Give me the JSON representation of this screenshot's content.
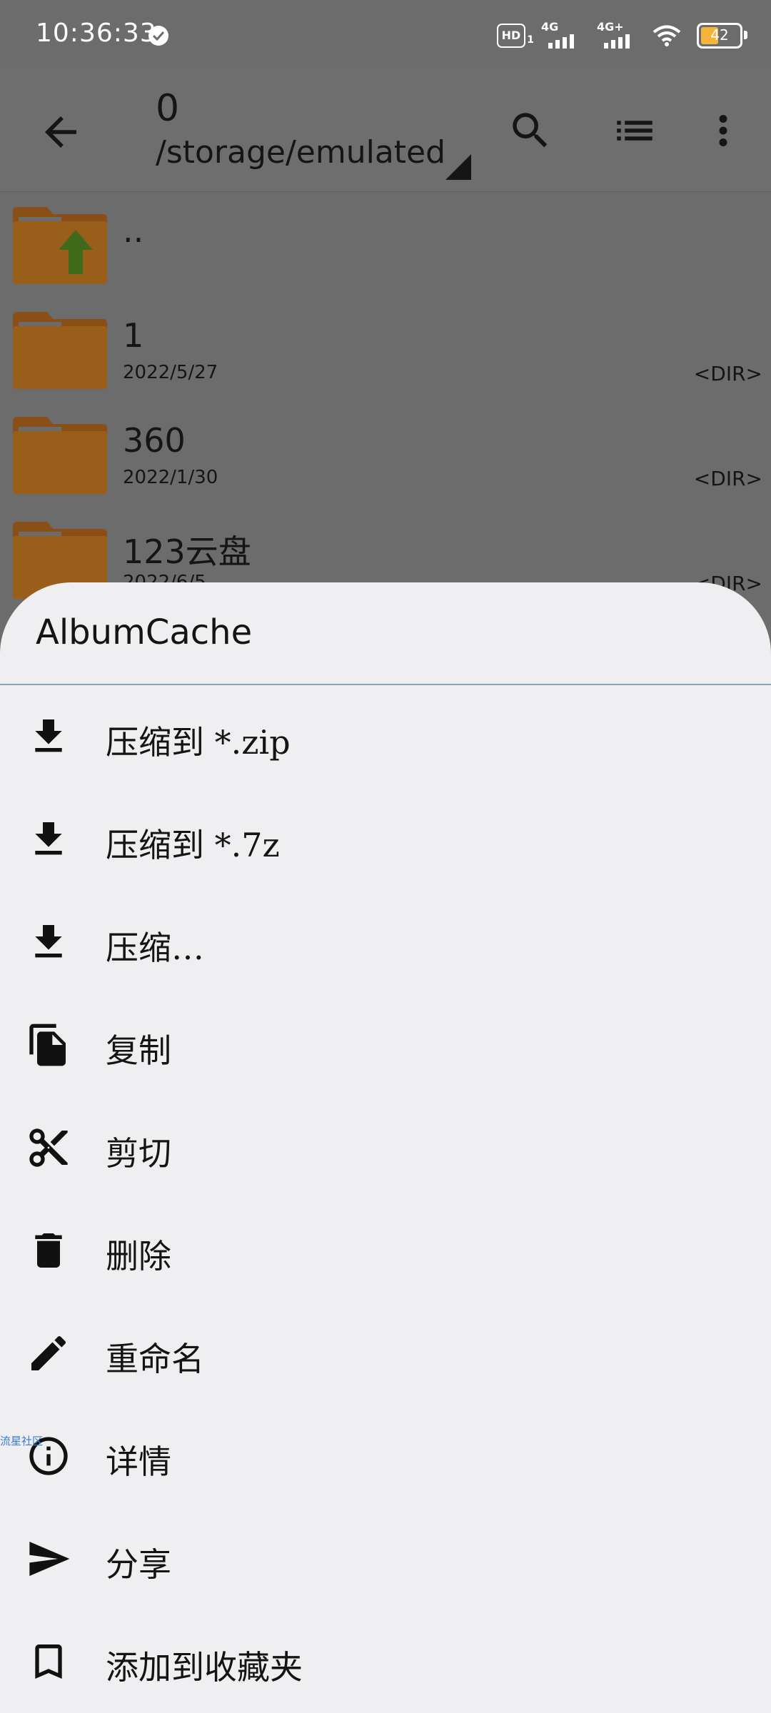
{
  "status_bar": {
    "time": "10:36:33",
    "hd": "HD",
    "hd_sub": "1",
    "net1": "4G",
    "net2": "4G+",
    "battery": "42"
  },
  "app_bar": {
    "path_top": "0",
    "path_sub": "/storage/emulated"
  },
  "files": [
    {
      "name": "..",
      "date": "",
      "type": ""
    },
    {
      "name": "1",
      "date": "2022/5/27",
      "type": "<DIR>"
    },
    {
      "name": "360",
      "date": "2022/1/30",
      "type": "<DIR>"
    },
    {
      "name": "123云盘",
      "date": "2022/6/5",
      "type": "<DIR>"
    }
  ],
  "sheet": {
    "title": "AlbumCache",
    "items": [
      {
        "label": "压缩到 *.zip",
        "icon": "download-icon"
      },
      {
        "label": "压缩到 *.7z",
        "icon": "download-icon"
      },
      {
        "label": "压缩…",
        "icon": "download-icon"
      },
      {
        "label": "复制",
        "icon": "copy-icon"
      },
      {
        "label": "剪切",
        "icon": "scissors-icon"
      },
      {
        "label": "删除",
        "icon": "trash-icon"
      },
      {
        "label": "重命名",
        "icon": "pencil-icon"
      },
      {
        "label": "详情",
        "icon": "info-icon"
      },
      {
        "label": "分享",
        "icon": "send-icon"
      },
      {
        "label": "添加到收藏夹",
        "icon": "bookmark-icon"
      }
    ]
  },
  "watermark": "流星社区",
  "colors": {
    "scrim": "#6c6c6c",
    "folder": "#a0631a",
    "sheet_bg": "#efeff1",
    "divider": "#87a8b3",
    "battery": "#f3b43b"
  }
}
